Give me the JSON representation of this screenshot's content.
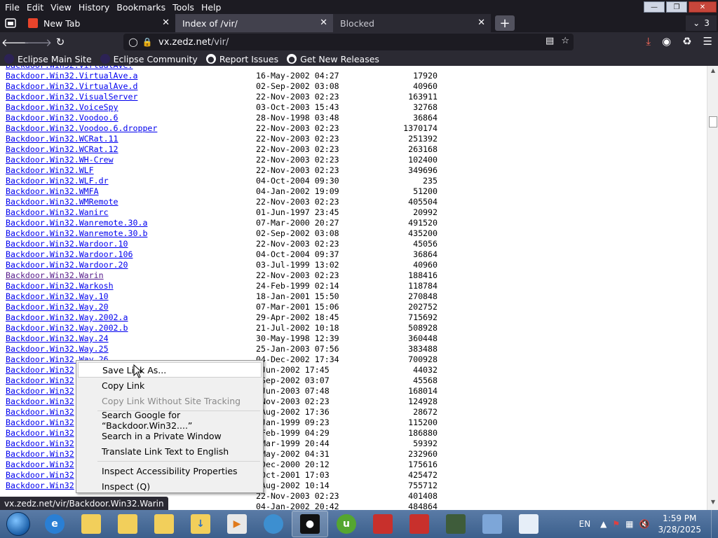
{
  "menubar": {
    "items": [
      "File",
      "Edit",
      "View",
      "History",
      "Bookmarks",
      "Tools",
      "Help"
    ]
  },
  "tabs": [
    {
      "label": "New Tab"
    },
    {
      "label": "Index of /vir/"
    },
    {
      "label": "Blocked"
    }
  ],
  "tab_count": "3",
  "url": {
    "host": "vx.zedz.net",
    "path": "/vir/"
  },
  "bookmarks": [
    {
      "label": "Eclipse Main Site",
      "icon": "eclipse-icon"
    },
    {
      "label": "Eclipse Community",
      "icon": "eclipse-icon"
    },
    {
      "label": "Report Issues",
      "icon": "github-icon"
    },
    {
      "label": "Get New Releases",
      "icon": "github-icon"
    }
  ],
  "listing": {
    "partial_top": {
      "name": "Backdoor.Win32.VirtualAve.",
      "date": "",
      "size": ""
    },
    "rows": [
      {
        "name": "Backdoor.Win32.VirtualAve.a",
        "date": "16-May-2002 04:27",
        "size": "17920"
      },
      {
        "name": "Backdoor.Win32.VirtualAve.d",
        "date": "02-Sep-2002 03:08",
        "size": "40960"
      },
      {
        "name": "Backdoor.Win32.VisualServer",
        "date": "22-Nov-2003 02:23",
        "size": "163911"
      },
      {
        "name": "Backdoor.Win32.VoiceSpy",
        "date": "03-Oct-2003 15:43",
        "size": "32768"
      },
      {
        "name": "Backdoor.Win32.Voodoo.6",
        "date": "28-Nov-1998 03:48",
        "size": "36864"
      },
      {
        "name": "Backdoor.Win32.Voodoo.6.dropper",
        "date": "22-Nov-2003 02:23",
        "size": "1370174"
      },
      {
        "name": "Backdoor.Win32.WCRat.11",
        "date": "22-Nov-2003 02:23",
        "size": "251392"
      },
      {
        "name": "Backdoor.Win32.WCRat.12",
        "date": "22-Nov-2003 02:23",
        "size": "263168"
      },
      {
        "name": "Backdoor.Win32.WH-Crew",
        "date": "22-Nov-2003 02:23",
        "size": "102400"
      },
      {
        "name": "Backdoor.Win32.WLF",
        "date": "22-Nov-2003 02:23",
        "size": "349696"
      },
      {
        "name": "Backdoor.Win32.WLF.dr",
        "date": "04-Oct-2004 09:30",
        "size": "235"
      },
      {
        "name": "Backdoor.Win32.WMFA",
        "date": "04-Jan-2002 19:09",
        "size": "51200"
      },
      {
        "name": "Backdoor.Win32.WMRemote",
        "date": "22-Nov-2003 02:23",
        "size": "405504"
      },
      {
        "name": "Backdoor.Win32.Wanirc",
        "date": "01-Jun-1997 23:45",
        "size": "20992"
      },
      {
        "name": "Backdoor.Win32.Wanremote.30.a",
        "date": "07-Mar-2000 20:27",
        "size": "491520"
      },
      {
        "name": "Backdoor.Win32.Wanremote.30.b",
        "date": "02-Sep-2002 03:08",
        "size": "435200"
      },
      {
        "name": "Backdoor.Win32.Wardoor.10",
        "date": "22-Nov-2003 02:23",
        "size": "45056"
      },
      {
        "name": "Backdoor.Win32.Wardoor.106",
        "date": "04-Oct-2004 09:37",
        "size": "36864"
      },
      {
        "name": "Backdoor.Win32.Wardoor.20",
        "date": "03-Jul-1999 13:02",
        "size": "40960"
      },
      {
        "name": "Backdoor.Win32.Warin",
        "date": "22-Nov-2003 02:23",
        "size": "188416",
        "visited": true
      },
      {
        "name": "Backdoor.Win32.Warkosh",
        "date": "24-Feb-1999 02:14",
        "size": "118784"
      },
      {
        "name": "Backdoor.Win32.Way.10",
        "date": "18-Jan-2001 15:50",
        "size": "270848"
      },
      {
        "name": "Backdoor.Win32.Way.20",
        "date": "07-Mar-2001 15:06",
        "size": "202752"
      },
      {
        "name": "Backdoor.Win32.Way.2002.a",
        "date": "29-Apr-2002 18:45",
        "size": "715692"
      },
      {
        "name": "Backdoor.Win32.Way.2002.b",
        "date": "21-Jul-2002 10:18",
        "size": "508928"
      },
      {
        "name": "Backdoor.Win32.Way.24",
        "date": "30-May-1998 12:39",
        "size": "360448"
      },
      {
        "name": "Backdoor.Win32.Way.25",
        "date": "25-Jan-2003 07:56",
        "size": "383488"
      },
      {
        "name": "Backdoor.Win32.Way.26",
        "date": "04-Dec-2002 17:34",
        "size": "700928"
      },
      {
        "name": "Backdoor.Win32",
        "date": "-Jun-2002 17:45",
        "size": "44032"
      },
      {
        "name": "Backdoor.Win32",
        "date": "-Sep-2002 03:07",
        "size": "45568"
      },
      {
        "name": "Backdoor.Win32",
        "date": "-Jun-2003 07:48",
        "size": "168014"
      },
      {
        "name": "Backdoor.Win32",
        "date": "-Nov-2003 02:23",
        "size": "124928"
      },
      {
        "name": "Backdoor.Win32",
        "date": "-Aug-2002 17:36",
        "size": "28672"
      },
      {
        "name": "Backdoor.Win32",
        "date": "-Jan-1999 09:23",
        "size": "115200"
      },
      {
        "name": "Backdoor.Win32",
        "date": "-Feb-1999 04:29",
        "size": "186880"
      },
      {
        "name": "Backdoor.Win32",
        "date": "-Mar-1999 20:44",
        "size": "59392"
      },
      {
        "name": "Backdoor.Win32",
        "date": "-May-2002 04:31",
        "size": "232960"
      },
      {
        "name": "Backdoor.Win32",
        "date": "-Dec-2000 20:12",
        "size": "175616"
      },
      {
        "name": "Backdoor.Win32",
        "date": "-Oct-2001 17:03",
        "size": "425472"
      },
      {
        "name": "Backdoor.Win32",
        "date": "-Aug-2002 10:14",
        "size": "755712"
      },
      {
        "name": "",
        "date": "22-Nov-2003 02:23",
        "size": "401408"
      },
      {
        "name": "",
        "date": "04-Jan-2002 20:42",
        "size": "484864"
      }
    ]
  },
  "context_menu": {
    "items": [
      {
        "label": "Save Link As...",
        "state": "hover"
      },
      {
        "label": "Copy Link",
        "state": "normal"
      },
      {
        "label": "Copy Link Without Site Tracking",
        "state": "disabled"
      },
      {
        "label": "Search Google for “Backdoor.Win32....”",
        "state": "normal"
      },
      {
        "label": "Search in a Private Window",
        "state": "normal"
      },
      {
        "label": "Translate Link Text to English",
        "state": "normal"
      },
      {
        "label": "Inspect Accessibility Properties",
        "state": "normal"
      },
      {
        "label": "Inspect (Q)",
        "state": "normal"
      }
    ]
  },
  "status_link": "vx.zedz.net/vir/Backdoor.Win32.Warin",
  "taskbar": {
    "language": "EN",
    "time": "1:59 PM",
    "date": "3/28/2025"
  },
  "colors": {
    "link": "#0000ee",
    "visited": "#551a8b",
    "chrome_dark": "#1c1b22",
    "toolbar": "#2b2a33",
    "download_accent": "#ff6b5b"
  }
}
